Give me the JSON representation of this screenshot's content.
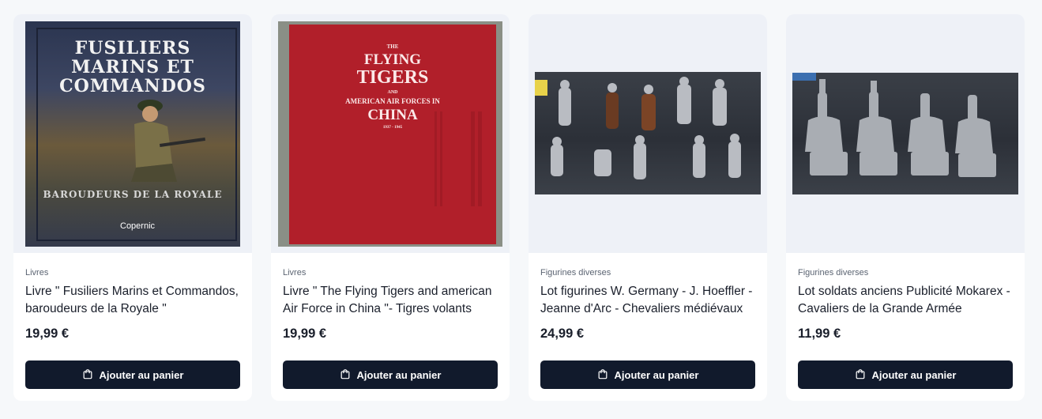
{
  "products": [
    {
      "category": "Livres",
      "title": "Livre \" Fusiliers Marins et Commandos, baroudeurs de la Royale \"",
      "price": "19,99 €",
      "cover_title": [
        "FUSILIERS",
        "MARINS   ET",
        "COMMANDOS"
      ],
      "cover_subtitle": "BAROUDEURS DE LA ROYALE",
      "cover_publisher": "Copernic"
    },
    {
      "category": "Livres",
      "title": "Livre \" The Flying Tigers and american Air Force in China \"- Tigres volants",
      "price": "19,99 €",
      "cover_small": "THE",
      "cover_title_1": "FLYING",
      "cover_title_2": "TIGERS",
      "cover_and": "AND",
      "cover_sub": "AMERICAN AIR FORCES IN",
      "cover_china": "CHINA",
      "cover_years": "1937 - 1945"
    },
    {
      "category": "Figurines diverses",
      "title": "Lot figurines W. Germany - J. Hoeffler - Jeanne d'Arc - Chevaliers médiévaux",
      "price": "24,99 €"
    },
    {
      "category": "Figurines diverses",
      "title": "Lot soldats anciens Publicité Mokarex - Cavaliers de la Grande Armée",
      "price": "11,99 €"
    }
  ],
  "add_to_cart_label": "Ajouter au panier",
  "colors": {
    "button": "#111a2c",
    "card": "#ffffff",
    "background": "#f6f8fa"
  },
  "icons": {
    "cart": "shopping-bag-icon"
  }
}
